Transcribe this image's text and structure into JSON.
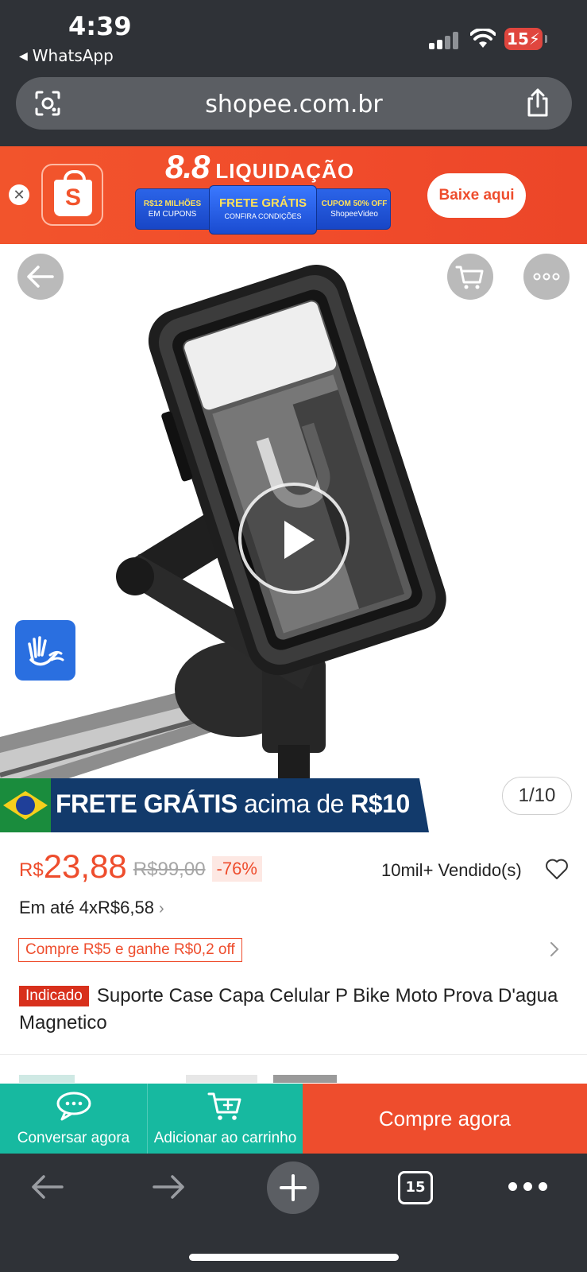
{
  "status_bar": {
    "time": "4:39",
    "back_app": "WhatsApp",
    "battery": "15"
  },
  "browser": {
    "url": "shopee.com.br",
    "tab_count": "15"
  },
  "banner": {
    "promo_title_big": "8.8",
    "promo_title_small": "LIQUIDAÇÃO",
    "promo1_top": "R$12 MILHÕES",
    "promo1_bottom": "EM CUPONS",
    "promo2_top": "FRETE GRÁTIS",
    "promo2_bottom": "CONFIRA CONDIÇÕES",
    "promo3_top": "CUPOM 50% OFF",
    "promo3_bottom": "ShopeeVideo",
    "download_label": "Baixe aqui",
    "logo_letter": "S"
  },
  "gallery": {
    "frete_bold_1": "FRETE GRÁTIS",
    "frete_mid": "acima de",
    "frete_bold_2": "R$10",
    "page_counter": "1/10"
  },
  "product": {
    "currency": "R$",
    "price": "23,88",
    "old_price": "R$99,00",
    "discount": "-76%",
    "sold": "10mil+ Vendido(s)",
    "installment": "Em até 4xR$6,58",
    "voucher": "Compre R$5 e ganhe R$0,2 off",
    "tag": "Indicado",
    "title": "Suporte Case Capa Celular P Bike Moto Prova D'agua Magnetico"
  },
  "actions": {
    "chat_label": "Conversar agora",
    "cart_label": "Adicionar ao carrinho",
    "buy_label": "Compre agora"
  },
  "colors": {
    "brand": "#ee4d2d",
    "teal": "#17b9a0",
    "browser_chrome": "#2f3237"
  },
  "icons": [
    "lens-icon",
    "share-icon",
    "back-arrow-icon",
    "cart-icon",
    "more-icon",
    "play-icon",
    "accessibility-hands-icon",
    "heart-icon",
    "chat-icon",
    "add-cart-icon",
    "chevron-right-icon"
  ]
}
